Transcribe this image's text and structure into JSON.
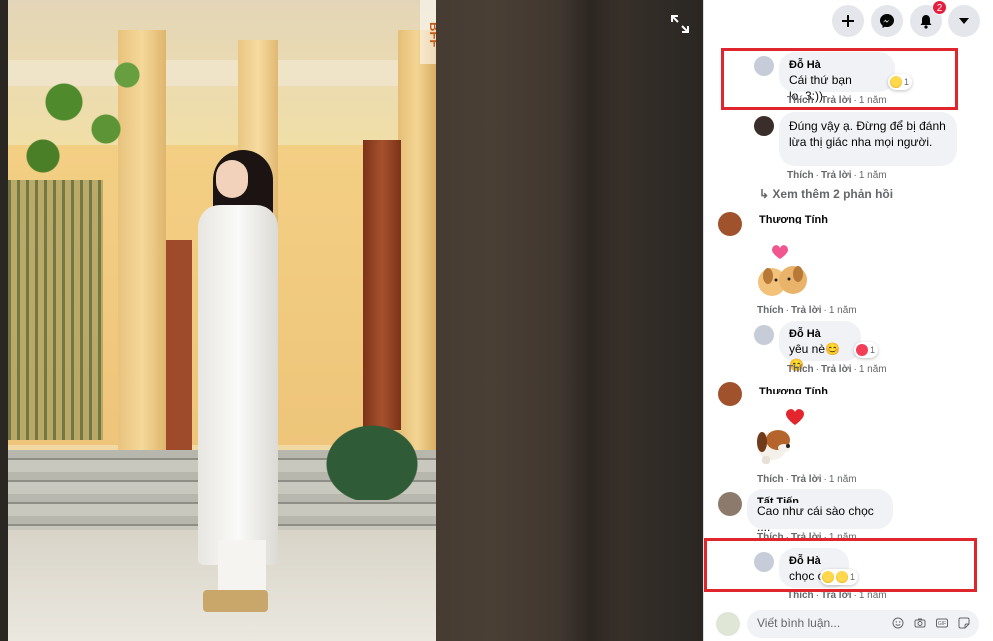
{
  "viewer": {
    "watermark": "BFF",
    "expand_label": "expand-icon"
  },
  "topbar": {
    "notifications_count": "2"
  },
  "comments": [
    {
      "id": "c1",
      "author": "Đỗ Hà",
      "text": "Cái thứ bạn lo..3:))",
      "reaction": "haha",
      "reaction_count": "1",
      "like": "Thích",
      "reply": "Trả lời",
      "time": "1 năm"
    },
    {
      "id": "c2",
      "author": "",
      "text": "Đúng vậy ạ. Đừng để bị đánh lừa thị giác nha mọi người.",
      "like": "Thích",
      "reply": "Trả lời",
      "time": "1 năm"
    },
    {
      "id": "more",
      "text": "Xem thêm 2 phản hồi"
    },
    {
      "id": "c3",
      "author": "Thương Tính",
      "sticker": "dogs-kissing-heart-sticker",
      "like": "Thích",
      "reply": "Trả lời",
      "time": "1 năm"
    },
    {
      "id": "c4",
      "author": "Đỗ Hà",
      "text": "yêu nè😊😊",
      "reaction": "love",
      "reaction_count": "1",
      "like": "Thích",
      "reply": "Trả lời",
      "time": "1 năm"
    },
    {
      "id": "c5",
      "author": "Thương Tính",
      "sticker": "dog-heart-sticker",
      "like": "Thích",
      "reply": "Trả lời",
      "time": "1 năm"
    },
    {
      "id": "c6",
      "author": "Tất Tiến",
      "text": "Cao như cái sào chọc ....",
      "like": "Thích",
      "reply": "Trả lời",
      "time": "1 năm"
    },
    {
      "id": "c7",
      "author": "Đỗ Hà",
      "text": "chọc c",
      "reaction": "haha",
      "reaction_count": "1",
      "like": "Thích",
      "reply": "Trả lời",
      "time": "1 năm"
    }
  ],
  "composer": {
    "placeholder": "Viết bình luận..."
  },
  "colors": {
    "highlight": "#e0262d",
    "bubble": "#f0f2f5",
    "badge": "#e41e3f"
  }
}
